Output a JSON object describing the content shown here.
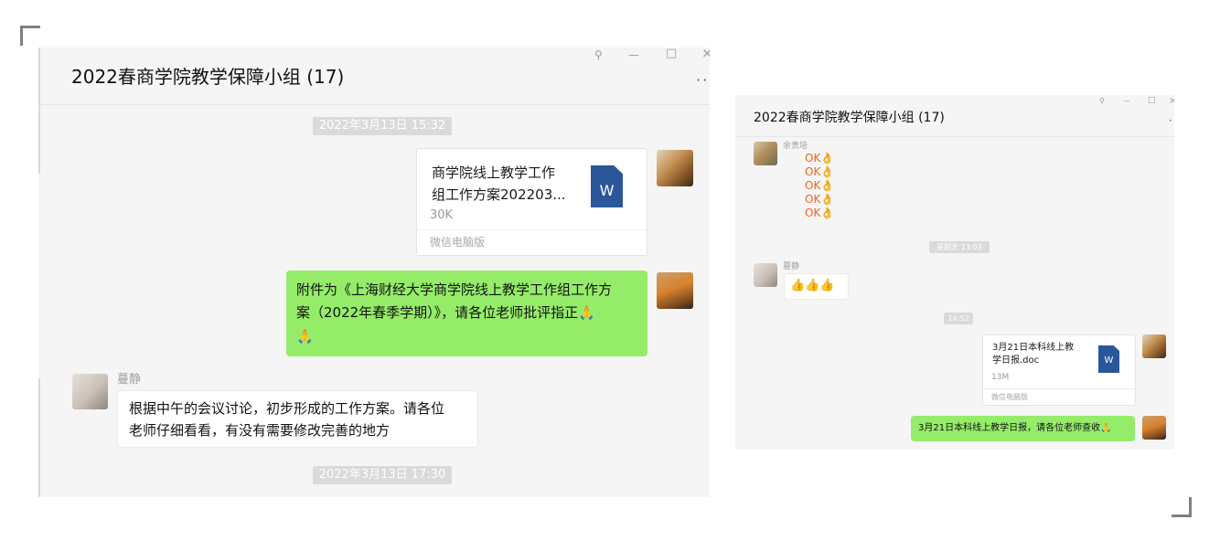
{
  "left": {
    "title": "2022春商学院教学保障小组 (17)",
    "window_controls": {
      "pin": "⚲",
      "minimize": "—",
      "maximize": "□",
      "close": "×",
      "more": "··"
    },
    "timestamps": [
      "2022年3月13日 15:32",
      "2022年3月13日 17:30"
    ],
    "file": {
      "name_line1": "商学院线上教学工作",
      "name_line2": "组工作方案202203...",
      "size": "30K",
      "source": "微信电脑版",
      "icon_letter": "W"
    },
    "green_message": {
      "line1": "附件为《上海财经大学商学院线上教学工作组工作方",
      "line2": "案（2022年春季学期）》，请各位老师批评指正🙏",
      "line3": "🙏"
    },
    "incoming": {
      "sender": "蔓静",
      "line1": "根据中午的会议讨论，初步形成的工作方案。请各位",
      "line2": "老师仔细看看，有没有需要修改完善的地方"
    }
  },
  "right": {
    "title": "2022春商学院教学保障小组 (17)",
    "window_controls": {
      "pin": "⚲",
      "minimize": "—",
      "maximize": "□",
      "close": "×",
      "more": "·"
    },
    "ok_sender": "余贵培",
    "ok_lines": [
      "OK👌",
      "OK👌",
      "OK👌",
      "OK👌",
      "OK👌"
    ],
    "timestamps": [
      "星期天 13:03",
      "14:52"
    ],
    "thumbs_sender": "蔓静",
    "thumbs": "👍👍👍",
    "file": {
      "name_line1": "3月21日本科线上教",
      "name_line2": "学日报.doc",
      "size": "13M",
      "source": "微信电脑版",
      "icon_letter": "W"
    },
    "green_message": "3月21日本科线上教学日报，请各位老师查收🙏"
  }
}
